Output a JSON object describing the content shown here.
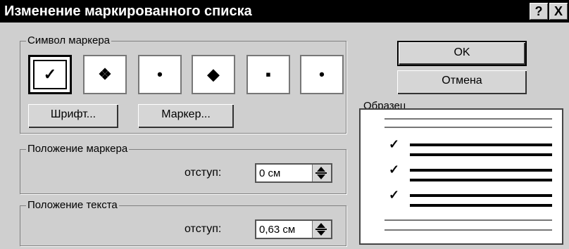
{
  "window": {
    "title": "Изменение маркированного списка",
    "help_label": "?",
    "close_label": "X"
  },
  "bullet_group": {
    "title": "Символ маркера",
    "symbols": [
      "✓",
      "❖",
      "•",
      "◆",
      "▪",
      "•"
    ],
    "selected_index": 0
  },
  "buttons": {
    "font": "Шрифт...",
    "marker": "Маркер...",
    "ok": "OK",
    "cancel": "Отмена"
  },
  "marker_position": {
    "title": "Положение маркера",
    "label": "отступ:",
    "value": "0 см"
  },
  "text_position": {
    "title": "Положение текста",
    "label": "отступ:",
    "value": "0,63 см"
  },
  "sample": {
    "title": "Образец",
    "check_symbol": "✓"
  }
}
